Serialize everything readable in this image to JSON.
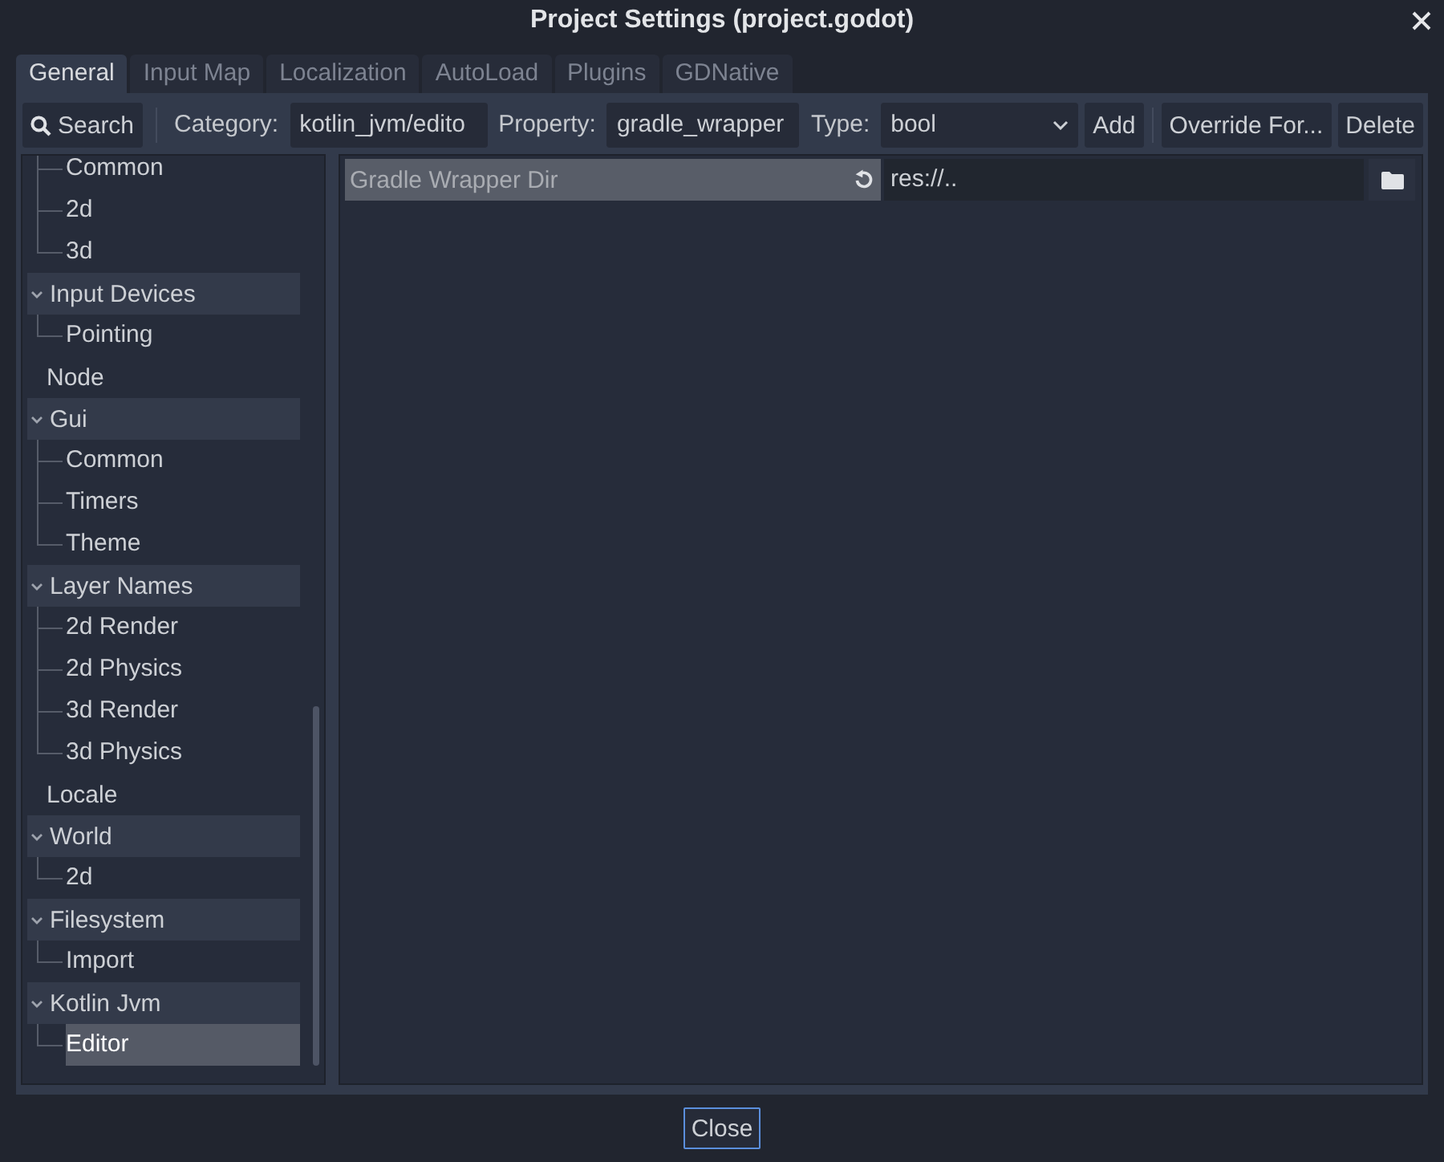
{
  "window": {
    "title": "Project Settings (project.godot)"
  },
  "tabs": [
    {
      "label": "General",
      "selected": true
    },
    {
      "label": "Input Map",
      "selected": false
    },
    {
      "label": "Localization",
      "selected": false
    },
    {
      "label": "AutoLoad",
      "selected": false
    },
    {
      "label": "Plugins",
      "selected": false
    },
    {
      "label": "GDNative",
      "selected": false
    }
  ],
  "toolbar": {
    "search_button": "Search",
    "category_label": "Category:",
    "category_field": {
      "value": "kotlin_jvm/edito"
    },
    "property_label": "Property:",
    "property_field": {
      "value": "gradle_wrapper"
    },
    "type_label": "Type:",
    "type_dropdown": {
      "value": "bool"
    },
    "add_button": "Add",
    "override_button": "Override For...",
    "delete_button": "Delete"
  },
  "tree": {
    "items": [
      {
        "children": [
          {
            "label": "Common",
            "selected": false
          },
          {
            "label": "2d",
            "selected": false
          },
          {
            "label": "3d",
            "selected": false
          }
        ]
      },
      {
        "label": "Input Devices",
        "selected": false,
        "expanded": true,
        "children": [
          {
            "label": "Pointing",
            "selected": false
          }
        ]
      },
      {
        "label": "Node",
        "selected": false
      },
      {
        "label": "Gui",
        "selected": false,
        "expanded": true,
        "children": [
          {
            "label": "Common",
            "selected": false
          },
          {
            "label": "Timers",
            "selected": false
          },
          {
            "label": "Theme",
            "selected": false
          }
        ]
      },
      {
        "label": "Layer Names",
        "selected": false,
        "expanded": true,
        "children": [
          {
            "label": "2d Render",
            "selected": false
          },
          {
            "label": "2d Physics",
            "selected": false
          },
          {
            "label": "3d Render",
            "selected": false
          },
          {
            "label": "3d Physics",
            "selected": false
          }
        ]
      },
      {
        "label": "Locale",
        "selected": false
      },
      {
        "label": "World",
        "selected": false,
        "expanded": true,
        "children": [
          {
            "label": "2d",
            "selected": false
          }
        ]
      },
      {
        "label": "Filesystem",
        "selected": false,
        "expanded": true,
        "children": [
          {
            "label": "Import",
            "selected": false
          }
        ]
      },
      {
        "label": "Kotlin Jvm",
        "selected": false,
        "expanded": true,
        "children": [
          {
            "label": "Editor",
            "selected": true
          }
        ]
      }
    ]
  },
  "properties": [
    {
      "label": "Gradle Wrapper Dir",
      "value": "res://..",
      "selected": true,
      "modified": true
    }
  ],
  "footer": {
    "close_button": "Close"
  }
}
